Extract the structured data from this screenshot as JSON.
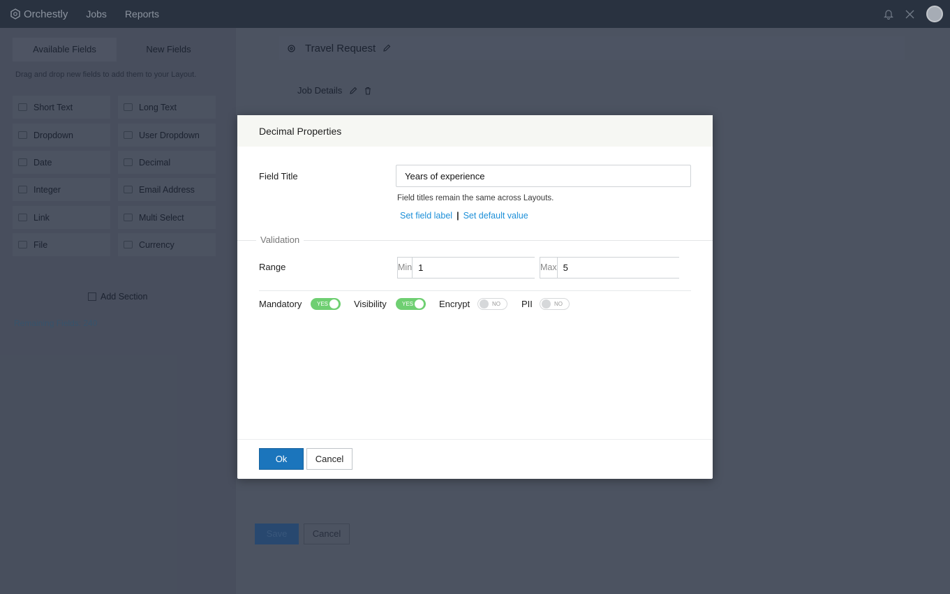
{
  "app": {
    "brand": "Orchestly",
    "nav": [
      "Jobs",
      "Reports"
    ],
    "icons": [
      "bell-icon",
      "tools-icon",
      "avatar"
    ]
  },
  "left_panel": {
    "tabs": [
      "Available Fields",
      "New Fields"
    ],
    "hint": "Drag and drop new fields to add them to your Layout.",
    "fields": [
      {
        "label": "Short Text",
        "icon": "short-text-icon"
      },
      {
        "label": "Long Text",
        "icon": "long-text-icon"
      },
      {
        "label": "Dropdown",
        "icon": "dropdown-icon"
      },
      {
        "label": "User Dropdown",
        "icon": "user-dropdown-icon"
      },
      {
        "label": "Date",
        "icon": "calendar-icon"
      },
      {
        "label": "Decimal",
        "icon": "decimal-icon"
      },
      {
        "label": "Integer",
        "icon": "integer-icon"
      },
      {
        "label": "Email Address",
        "icon": "email-icon"
      },
      {
        "label": "Link",
        "icon": "link-icon"
      },
      {
        "label": "Multi Select",
        "icon": "multi-select-icon"
      },
      {
        "label": "File",
        "icon": "file-icon"
      },
      {
        "label": "Currency",
        "icon": "currency-icon"
      }
    ],
    "add_section": "Add Section",
    "remaining": "Remaining Fields: 240"
  },
  "form": {
    "title": "Travel Request",
    "section": "Job Details",
    "save_label": "Save",
    "cancel_label": "Cancel"
  },
  "modal": {
    "title": "Decimal Properties",
    "field_title_label": "Field Title",
    "field_title_value": "Years of experience",
    "helper": "Field titles remain the same across Layouts.",
    "link_label": "Set field label",
    "link_default": "Set default value",
    "link_separator": "|",
    "validation_legend": "Validation",
    "range_label": "Range",
    "min_prefix": "Min",
    "min_value": "1",
    "max_prefix": "Max",
    "max_value": "5",
    "toggles": [
      {
        "label": "Mandatory",
        "state": "YES",
        "on": true
      },
      {
        "label": "Visibility",
        "state": "YES",
        "on": true
      },
      {
        "label": "Encrypt",
        "state": "NO",
        "on": false
      },
      {
        "label": "PII",
        "state": "NO",
        "on": false
      }
    ],
    "ok_label": "Ok",
    "cancel_label": "Cancel"
  },
  "colors": {
    "primary": "#1b75bc",
    "link": "#1c8fd8",
    "toggle_on": "#6fcf72"
  }
}
